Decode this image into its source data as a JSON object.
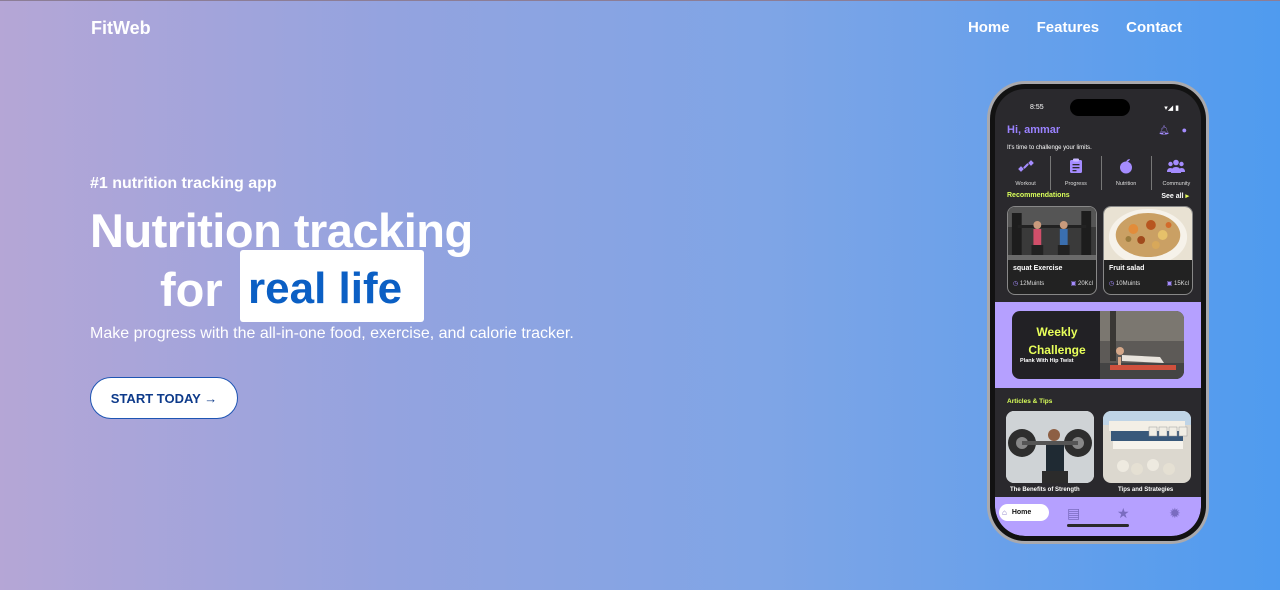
{
  "brand": "FitWeb",
  "nav": [
    "Home",
    "Features",
    "Contact"
  ],
  "hero": {
    "tagline": "#1 nutrition tracking app",
    "title_line1": "Nutrition tracking",
    "title_line2_prefix": "for",
    "title_highlight": "real life",
    "subtitle": "Make progress with the all-in-one food, exercise, and calorie tracker.",
    "cta": "START TODAY →"
  },
  "colors": {
    "accent": "#0b5fc4",
    "app_purple": "#b5a0ff",
    "app_lime": "#d9ff5a"
  },
  "app": {
    "status_time": "8:55",
    "greeting": "Hi, ammar",
    "motto": "It's time to challenge your limits.",
    "categories": [
      {
        "label": "Workout",
        "icon": "dumbbell-icon"
      },
      {
        "label": "Progress",
        "icon": "clipboard-icon"
      },
      {
        "label": "Nutrition",
        "icon": "apple-icon"
      },
      {
        "label": "Community",
        "icon": "people-icon"
      }
    ],
    "recommendations_label": "Recommendations",
    "see_all": "See all",
    "recommendations": [
      {
        "title": "squat Exercise",
        "time": "12Muints",
        "kcal": "20Kcl"
      },
      {
        "title": "Fruit salad",
        "time": "10Muints",
        "kcal": "15Kcl"
      }
    ],
    "challenge": {
      "title": "Weekly Challenge",
      "subtitle": "Plank With Hip Twist"
    },
    "articles_label": "Articles & Tips",
    "articles": [
      {
        "title": "The Benefits of Strength"
      },
      {
        "title": "Tips and Strategies"
      }
    ],
    "bottom_nav": {
      "home": "Home"
    }
  }
}
